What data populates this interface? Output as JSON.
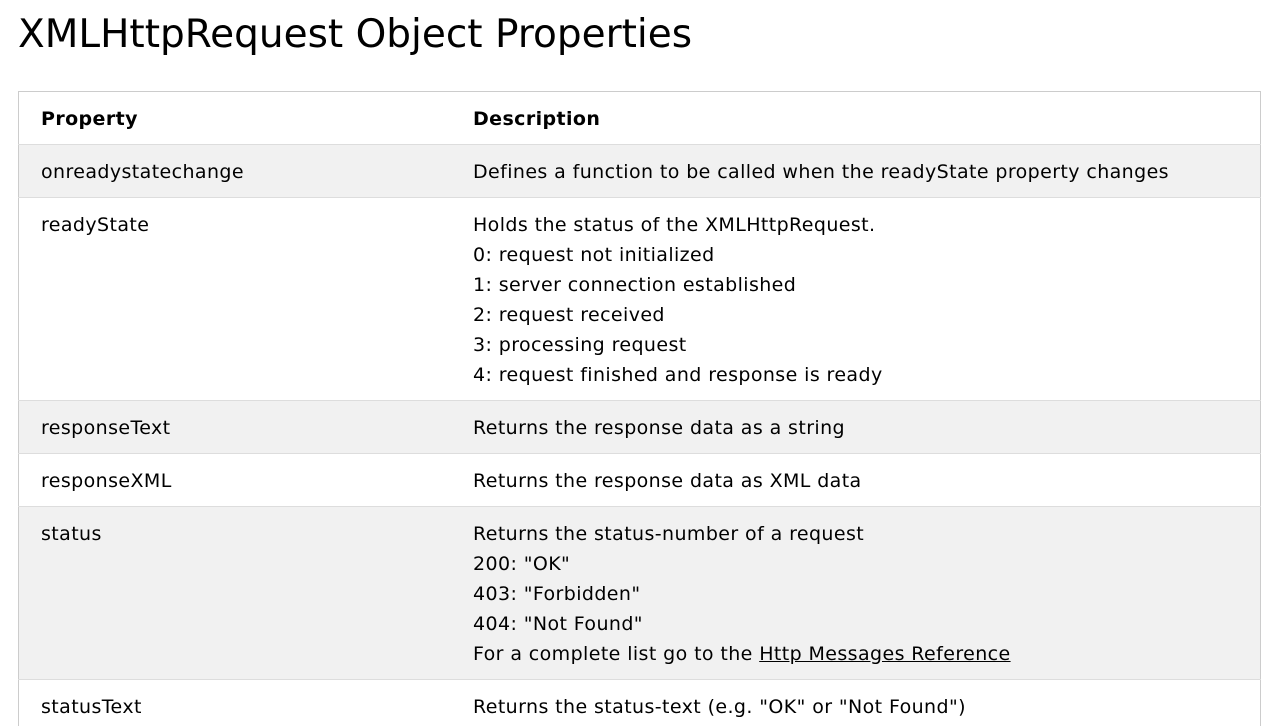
{
  "page": {
    "title": "XMLHttpRequest Object Properties"
  },
  "table": {
    "headers": {
      "property": "Property",
      "description": "Description"
    },
    "rows": [
      {
        "property": "onreadystatechange",
        "description": [
          "Defines a function to be called when the readyState property changes"
        ]
      },
      {
        "property": "readyState",
        "description": [
          "Holds the status of the XMLHttpRequest.",
          "0: request not initialized",
          "1: server connection established",
          "2: request received",
          "3: processing request",
          "4: request finished and response is ready"
        ]
      },
      {
        "property": "responseText",
        "description": [
          "Returns the response data as a string"
        ]
      },
      {
        "property": "responseXML",
        "description": [
          "Returns the response data as XML data"
        ]
      },
      {
        "property": "status",
        "description": [
          "Returns the status-number of a request",
          "200: \"OK\"",
          "403: \"Forbidden\"",
          "404: \"Not Found\""
        ],
        "link_prefix": "For a complete list go to the ",
        "link_text": "Http Messages Reference"
      },
      {
        "property": "statusText",
        "description": [
          "Returns the status-text (e.g. \"OK\" or \"Not Found\")"
        ]
      }
    ]
  },
  "colors": {
    "row_shade": "#f1f1f1",
    "border": "#cccccc",
    "text": "#000000"
  }
}
